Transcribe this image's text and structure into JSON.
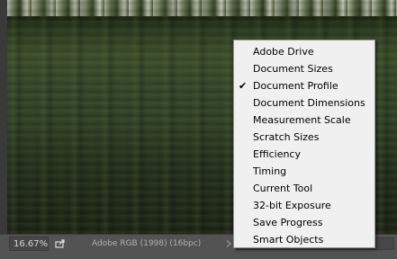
{
  "status_bar": {
    "zoom": "16.67%",
    "document_info": "Adobe RGB (1998) (16bpc)",
    "share_icon": "share-export-icon",
    "info_arrow_icon": "chevron-right-icon"
  },
  "menu": {
    "items": [
      {
        "label": "Adobe Drive",
        "checked": false
      },
      {
        "label": "Document Sizes",
        "checked": false
      },
      {
        "label": "Document Profile",
        "checked": true
      },
      {
        "label": "Document Dimensions",
        "checked": false
      },
      {
        "label": "Measurement Scale",
        "checked": false
      },
      {
        "label": "Scratch Sizes",
        "checked": false
      },
      {
        "label": "Efficiency",
        "checked": false
      },
      {
        "label": "Timing",
        "checked": false
      },
      {
        "label": "Current Tool",
        "checked": false
      },
      {
        "label": "32-bit Exposure",
        "checked": false
      },
      {
        "label": "Save Progress",
        "checked": false
      },
      {
        "label": "Smart Objects",
        "checked": false
      }
    ],
    "check_glyph": "✔"
  },
  "colors": {
    "menu_background": "#f0f0f0",
    "menu_border": "#979797",
    "status_bar": "#535353"
  }
}
